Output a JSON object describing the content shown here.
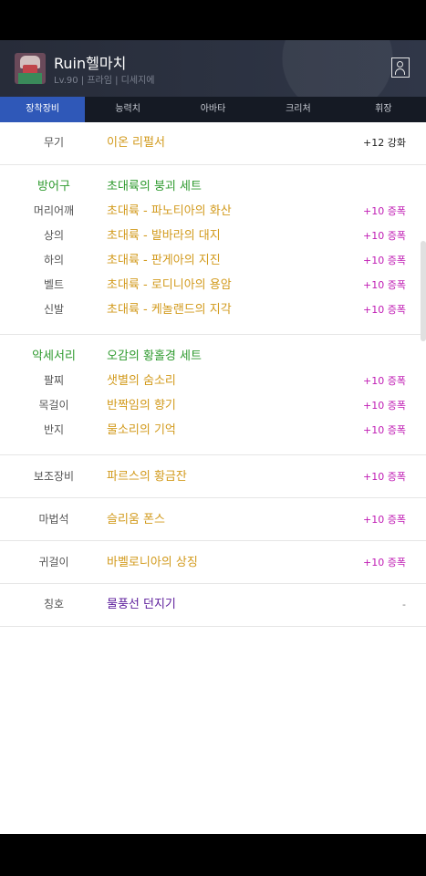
{
  "header": {
    "character_name": "Ruin헬마치",
    "character_info": "Lv.90 | 프라임 | 디세지에"
  },
  "tabs": [
    "장착장비",
    "능력치",
    "아바타",
    "크리처",
    "휘장"
  ],
  "equipment": {
    "weapon": {
      "label": "무기",
      "item": "이온 리펄서",
      "value": "+12 강화"
    },
    "armor_set": {
      "label": "방어구",
      "set_name": "초대륙의 붕괴 세트"
    },
    "armor": [
      {
        "label": "머리어깨",
        "item": "초대륙 - 파노티아의 화산",
        "value": "+10 증폭"
      },
      {
        "label": "상의",
        "item": "초대륙 - 발바라의 대지",
        "value": "+10 증폭"
      },
      {
        "label": "하의",
        "item": "초대륙 - 판게아의 지진",
        "value": "+10 증폭"
      },
      {
        "label": "벨트",
        "item": "초대륙 - 로디니아의 용암",
        "value": "+10 증폭"
      },
      {
        "label": "신발",
        "item": "초대륙 - 케놀랜드의 지각",
        "value": "+10 증폭"
      }
    ],
    "accessory_set": {
      "label": "악세서리",
      "set_name": "오감의 황홀경 세트"
    },
    "accessories": [
      {
        "label": "팔찌",
        "item": "샛별의 숨소리",
        "value": "+10 증폭"
      },
      {
        "label": "목걸이",
        "item": "반짝임의 향기",
        "value": "+10 증폭"
      },
      {
        "label": "반지",
        "item": "물소리의 기억",
        "value": "+10 증폭"
      }
    ],
    "sub_equipment": {
      "label": "보조장비",
      "item": "파르스의 황금잔",
      "value": "+10 증폭"
    },
    "magic_stone": {
      "label": "마법석",
      "item": "슬리움 폰스",
      "value": "+10 증폭"
    },
    "earring": {
      "label": "귀걸이",
      "item": "바벨로니아의 상징",
      "value": "+10 증폭"
    },
    "title": {
      "label": "칭호",
      "item": "물풍선 던지기",
      "value": "-"
    }
  }
}
